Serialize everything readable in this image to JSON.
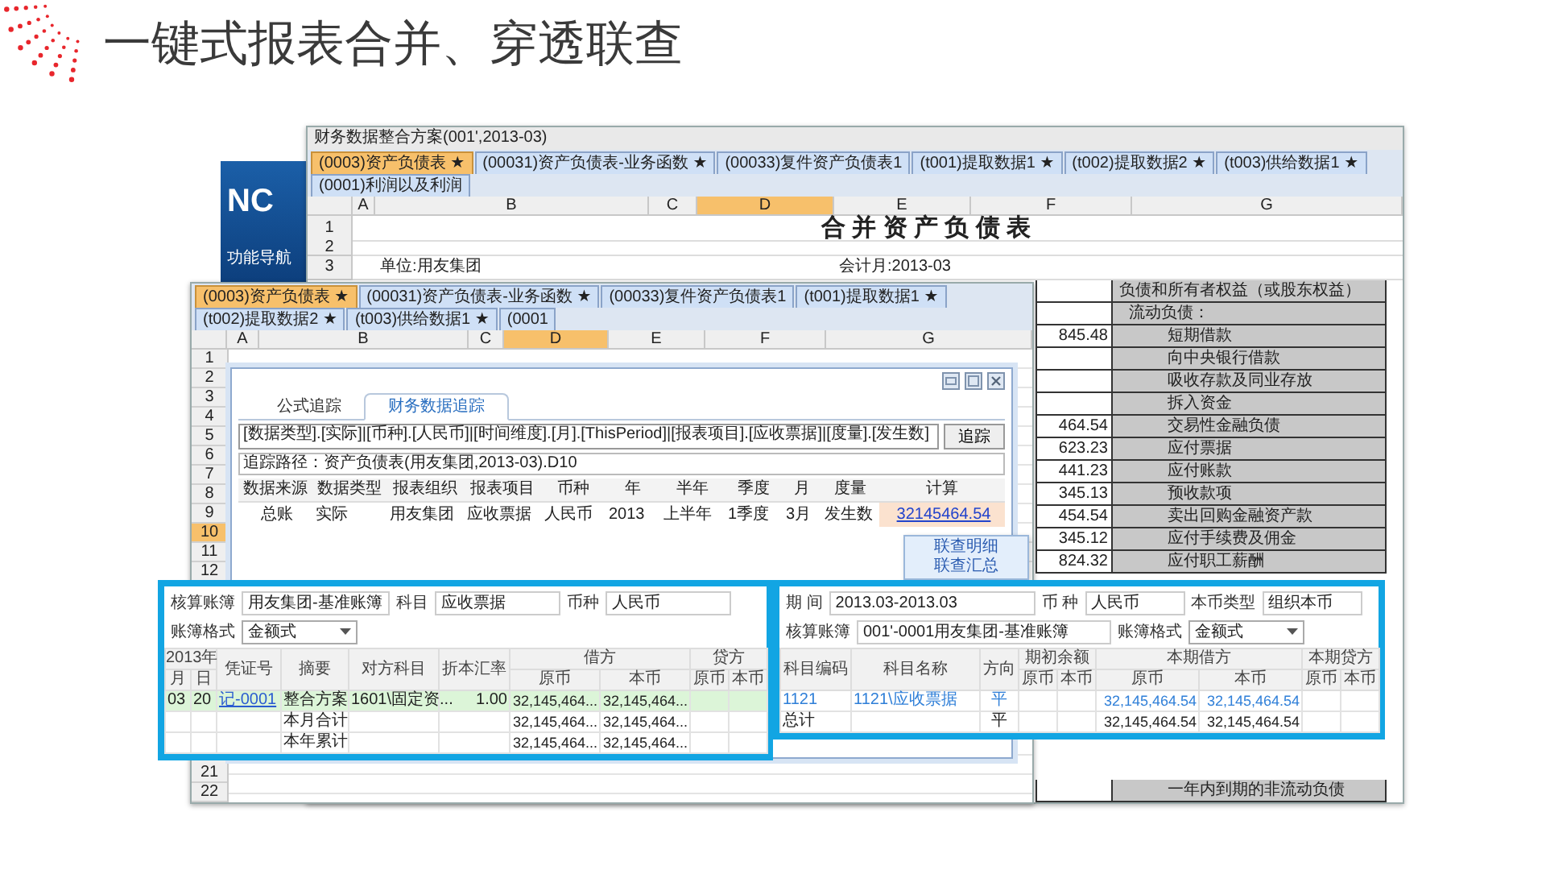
{
  "slide": {
    "title": "一键式报表合并、穿透联查"
  },
  "nav_panel": {
    "logo": "NC",
    "label": "功能导航"
  },
  "report_window": {
    "title": "财务数据整合方案(001',2013-03)",
    "tabs": [
      {
        "label": "(0003)资产负债表 ★",
        "selected": true
      },
      {
        "label": "(00031)资产负债表-业务函数 ★",
        "selected": false
      },
      {
        "label": "(00033)复件资产负债表1",
        "selected": false
      },
      {
        "label": "(t001)提取数据1 ★",
        "selected": false
      },
      {
        "label": "(t002)提取数据2 ★",
        "selected": false
      },
      {
        "label": "(t003)供给数据1 ★",
        "selected": false
      },
      {
        "label": "(0001)利润以及利润",
        "selected": false
      }
    ],
    "columns": [
      {
        "label": "A",
        "selected": false
      },
      {
        "label": "B",
        "selected": false
      },
      {
        "label": "C",
        "selected": false
      },
      {
        "label": "D",
        "selected": true
      },
      {
        "label": "E",
        "selected": false
      },
      {
        "label": "F",
        "selected": false
      },
      {
        "label": "G",
        "selected": false
      }
    ],
    "row_numbers": [
      "1",
      "2",
      "3"
    ],
    "sheet_title": "合 并 资 产 负 债 表",
    "unit": "单位:用友集团",
    "period": "会计月:2013-03",
    "liabilities_header": "负债和所有者权益（或股东权益）",
    "liabilities": [
      {
        "label": "流动负债：",
        "children": [
          {
            "label": "短期借款",
            "amount": "845.48"
          },
          {
            "label": "向中央银行借款"
          },
          {
            "label": "吸收存款及同业存放"
          },
          {
            "label": "拆入资金"
          },
          {
            "label": "交易性金融负债",
            "amount": "464.54"
          },
          {
            "label": "应付票据",
            "amount": "623.23"
          },
          {
            "label": "应付账款",
            "amount": "441.23"
          },
          {
            "label": "预收款项",
            "amount": "345.13"
          },
          {
            "label": "卖出回购金融资产款",
            "amount": "454.54"
          },
          {
            "label": "应付手续费及佣金",
            "amount": "345.12"
          },
          {
            "label": "应付职工薪酬",
            "amount": "824.32"
          }
        ]
      }
    ],
    "liabilities_continued": [
      "一年内到期的非流动负债"
    ]
  },
  "sheet_window": {
    "tabs": [
      {
        "label": "(0003)资产负债表 ★",
        "selected": true
      },
      {
        "label": "(00031)资产负债表-业务函数 ★",
        "selected": false
      },
      {
        "label": "(00033)复件资产负债表1",
        "selected": false
      },
      {
        "label": "(t001)提取数据1 ★",
        "selected": false
      },
      {
        "label": "(t002)提取数据2 ★",
        "selected": false
      },
      {
        "label": "(t003)供给数据1 ★",
        "selected": false
      },
      {
        "label": "(0001",
        "selected": false
      }
    ],
    "columns": [
      {
        "label": "A",
        "selected": false
      },
      {
        "label": "B",
        "selected": false
      },
      {
        "label": "C",
        "selected": false
      },
      {
        "label": "D",
        "selected": true
      },
      {
        "label": "E",
        "selected": false
      },
      {
        "label": "F",
        "selected": false
      },
      {
        "label": "G",
        "selected": false
      }
    ],
    "row_numbers_top": [
      {
        "label": "1",
        "selected": false
      },
      {
        "label": "2",
        "selected": false
      },
      {
        "label": "3",
        "selected": false
      },
      {
        "label": "4",
        "selected": false
      },
      {
        "label": "5",
        "selected": false
      },
      {
        "label": "6",
        "selected": false
      },
      {
        "label": "7",
        "selected": false
      },
      {
        "label": "8",
        "selected": false
      },
      {
        "label": "9",
        "selected": false
      },
      {
        "label": "10",
        "selected": true
      },
      {
        "label": "11",
        "selected": false
      },
      {
        "label": "12",
        "selected": false
      }
    ],
    "row_numbers_bottom": [
      {
        "label": "21",
        "selected": false
      },
      {
        "label": "22",
        "selected": false
      }
    ]
  },
  "trace_dialog": {
    "tabs": [
      {
        "label": "公式追踪",
        "selected": false
      },
      {
        "label": "财务数据追踪",
        "selected": true
      }
    ],
    "formula": "[数据类型].[实际]|[币种].[人民币]|[时间维度].[月].[ThisPeriod]|[报表项目].[应收票据]|[度量].[发生数]",
    "trace_button": "追踪",
    "path": "追踪路径：资产负债表(用友集团,2013-03).D10",
    "columns": [
      "数据来源",
      "数据类型",
      "报表组织",
      "报表项目",
      "币种",
      "年",
      "半年",
      "季度",
      "月",
      "度量",
      "计算"
    ],
    "rows": [
      {
        "cells": [
          "总账",
          "实际",
          "用友集团",
          "应收票据",
          "人民币",
          "2013",
          "上半年",
          "1季度",
          "3月",
          "发生数"
        ],
        "result": "32145464.54"
      }
    ],
    "menu": [
      {
        "label": "联查明细"
      },
      {
        "label": "联查汇总"
      }
    ]
  },
  "ledger": {
    "fields": [
      {
        "label": "核算账簿",
        "value": "用友集团-基准账簿"
      },
      {
        "label": "科目",
        "value": "应收票据"
      },
      {
        "label": "币种",
        "value": "人民币"
      }
    ],
    "format": {
      "label": "账簿格式",
      "value": "金额式"
    },
    "columns": {
      "year": "2013年",
      "month": "月",
      "day": "日",
      "voucher": "凭证号",
      "summary": "摘要",
      "account": "对方科目",
      "rate": "折本汇率",
      "debit": "借方",
      "credit": "贷方",
      "sub": [
        "原币",
        "本币",
        "原币",
        "本币"
      ]
    },
    "rows": [
      {
        "selected": true,
        "month": "03",
        "day": "20",
        "voucher": "记-0001",
        "summary": "整合方案",
        "account": "1601\\固定资...",
        "rate": "1.00",
        "debit_orig": "32,145,464...",
        "debit_local": "32,145,464..."
      },
      {
        "selected": false,
        "summary": "本月合计",
        "debit_orig": "32,145,464...",
        "debit_local": "32,145,464..."
      },
      {
        "selected": false,
        "summary": "本年累计",
        "debit_orig": "32,145,464...",
        "debit_local": "32,145,464..."
      }
    ]
  },
  "balance": {
    "fields": [
      {
        "label": "期 间",
        "value": "2013.03-2013.03"
      },
      {
        "label": "币 种",
        "value": "人民币"
      },
      {
        "label": "本币类型",
        "value": "组织本币"
      }
    ],
    "book": {
      "label": "核算账簿",
      "value": "001'-0001用友集团-基准账簿"
    },
    "format": {
      "label": "账簿格式",
      "value": "金额式"
    },
    "columns": {
      "code": "科目编码",
      "name": "科目名称",
      "direction": "方向",
      "groups": [
        "期初余额",
        "本期借方",
        "本期贷方"
      ],
      "sub": [
        "原币",
        "本币",
        "原币",
        "本币",
        "原币",
        "本币"
      ]
    },
    "rows": [
      {
        "kind": "detail",
        "code": "1121",
        "name": "1121\\应收票据",
        "direction": "平",
        "debit_orig": "32,145,464.54",
        "debit_local": "32,145,464.54"
      },
      {
        "kind": "total",
        "code": "总计",
        "direction": "平",
        "debit_orig": "32,145,464.54",
        "debit_local": "32,145,464.54"
      }
    ]
  }
}
